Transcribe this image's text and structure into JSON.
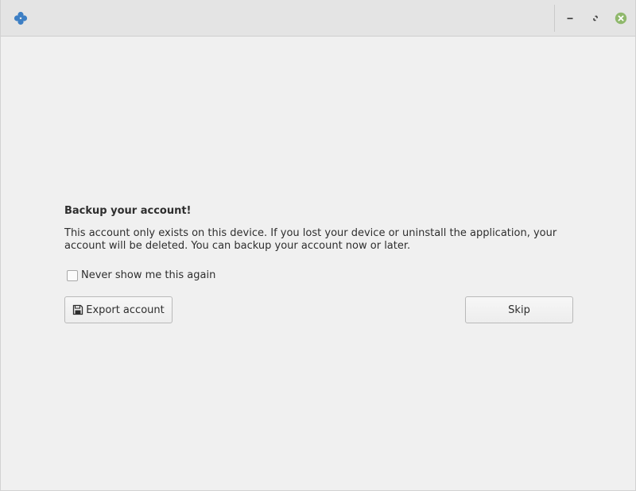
{
  "window": {
    "controls": {
      "minimize_icon": "minimize-icon",
      "maximize_icon": "maximize-icon",
      "close_icon": "close-icon",
      "close_color": "#8fb86c"
    },
    "app_icon": "clover-icon",
    "app_icon_color": "#3d7fc4"
  },
  "dialog": {
    "heading": "Backup your account!",
    "message": "This account only exists on this device. If you lost your device or uninstall the application, your account will be deleted. You can backup your account now or later.",
    "checkbox_label": "Never show me this again",
    "checkbox_checked": false,
    "export_label": "Export account",
    "export_icon": "save-icon",
    "skip_label": "Skip"
  }
}
